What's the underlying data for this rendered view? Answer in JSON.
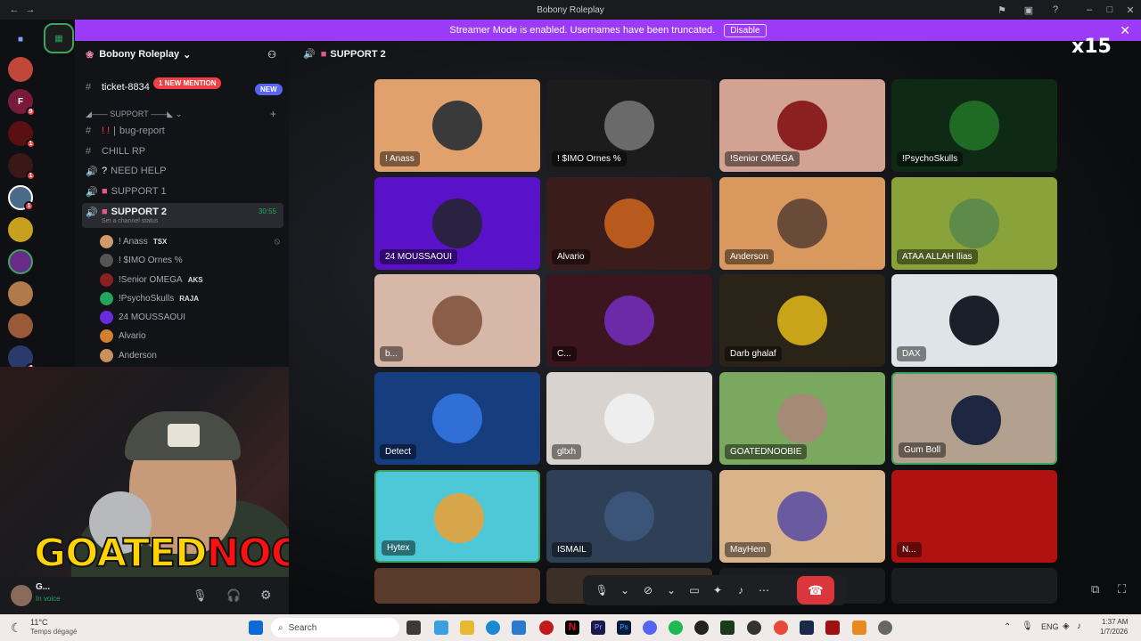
{
  "window": {
    "title": "Bobony Roleplay"
  },
  "banner": {
    "text": "Streamer Mode is enabled. Usernames have been truncated.",
    "button": "Disable"
  },
  "server": {
    "name": "Bobony Roleplay"
  },
  "channels": {
    "ticket": "ticket-8834",
    "mention_pill": "1 NEW MENTION",
    "new_pill": "NEW",
    "category": "SUPPORT",
    "bug_report": "bug-report",
    "chill": "CHILL RP",
    "need_help": "NEED HELP",
    "support1": "SUPPORT 1",
    "support2": "SUPPORT 2",
    "support2_time": "30:55",
    "support2_status": "Set a channel status"
  },
  "members": [
    {
      "name": "! Anass",
      "tag": "TSX"
    },
    {
      "name": "! $IMO Ornes %",
      "tag": ""
    },
    {
      "name": "!Senior OMEGA",
      "tag": "AKS"
    },
    {
      "name": "!PsychoSkulls",
      "tag": "RAJA"
    },
    {
      "name": "24 MOUSSAOUI",
      "tag": ""
    },
    {
      "name": "Alvario",
      "tag": ""
    },
    {
      "name": "Anderson",
      "tag": ""
    }
  ],
  "user": {
    "name": "G...",
    "status": "In voice"
  },
  "overlay": {
    "goated": "GOATED",
    "noobie": "NOOBIE",
    "multiplier": "x15"
  },
  "voice": {
    "channel_title": "SUPPORT 2"
  },
  "tiles": [
    {
      "name": "! Anass",
      "bg": "#e1a16c",
      "av": "#3a3a3a"
    },
    {
      "name": "! $IMO Ornes %",
      "bg": "#1c1c1c",
      "av": "#6a6a6a"
    },
    {
      "name": "!Senior OMEGA",
      "bg": "#d2a393",
      "av": "#8a2020"
    },
    {
      "name": "!PsychoSkulls",
      "bg": "#0f2a14",
      "av": "#1f6a24"
    },
    {
      "name": "24 MOUSSAOUI",
      "bg": "#5a12c9",
      "av": "#2b2140"
    },
    {
      "name": "Alvario",
      "bg": "#3a1c1a",
      "av": "#b85a1e"
    },
    {
      "name": "Anderson",
      "bg": "#d9995e",
      "av": "#6a4b3a"
    },
    {
      "name": "ATAA ALLAH Ilias",
      "bg": "#8aa23a",
      "av": "#5e8a4a"
    },
    {
      "name": "b...",
      "bg": "#d7b7a8",
      "av": "#8b5e4a"
    },
    {
      "name": "C...",
      "bg": "#3b1520",
      "av": "#6c2aa8"
    },
    {
      "name": "Darb ghalaf",
      "bg": "#2a2418",
      "av": "#c9a418"
    },
    {
      "name": "DAX",
      "bg": "#dfe4e8",
      "av": "#1a1f2a"
    },
    {
      "name": "Detect",
      "bg": "#163d7e",
      "av": "#2f6fd6"
    },
    {
      "name": "gltxh",
      "bg": "#d9d3cf",
      "av": "#eeeeee"
    },
    {
      "name": "GOATEDNOOBIE",
      "bg": "#7aa85e",
      "av": "#a58a78"
    },
    {
      "name": "Gum Boll",
      "bg": "#b3a08e",
      "av": "#1d2840"
    },
    {
      "name": "Hytex",
      "bg": "#4ec8d6",
      "av": "#d8a64a"
    },
    {
      "name": "ISMAIL",
      "bg": "#2f3f55",
      "av": "#3a5577"
    },
    {
      "name": "MayHem",
      "bg": "#d9b48a",
      "av": "#6a5aa0"
    },
    {
      "name": "N...",
      "bg": "#b01212",
      "av": "#b01212"
    }
  ],
  "taskbar": {
    "weather_temp": "11°C",
    "weather_desc": "Temps dégagé",
    "search": "Search",
    "lang": "ENG",
    "time": "1:37 AM",
    "date": "1/7/2026"
  }
}
